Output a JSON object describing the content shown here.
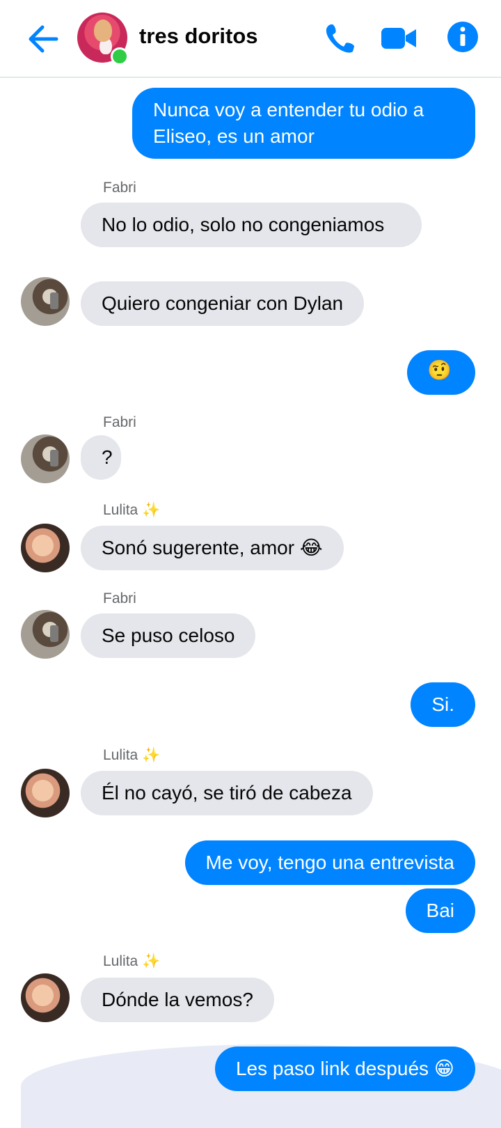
{
  "header": {
    "title": "tres doritos",
    "icons": [
      "back-arrow-icon",
      "phone-icon",
      "video-camera-icon",
      "info-icon"
    ],
    "accent_color": "#0084ff",
    "online_color": "#31cc46"
  },
  "messages": [
    {
      "sender": "me",
      "text": "Nunca voy a entender tu odio a Eliseo, es un amor"
    },
    {
      "sender": "Fabri",
      "label": "Fabri",
      "text": "No lo odio, solo no congeniamos"
    },
    {
      "sender": "Fabri",
      "text": "Quiero congeniar con Dylan"
    },
    {
      "sender": "me",
      "text": "🤨"
    },
    {
      "sender": "Fabri",
      "label": "Fabri",
      "text": "?"
    },
    {
      "sender": "Lulita",
      "label": "Lulita ✨",
      "text": "Sonó sugerente, amor 😂"
    },
    {
      "sender": "Fabri",
      "label": "Fabri",
      "text": "Se puso celoso"
    },
    {
      "sender": "me",
      "text": "Si."
    },
    {
      "sender": "Lulita",
      "label": "Lulita ✨",
      "text": "Él no cayó, se tiró de cabeza"
    },
    {
      "sender": "me",
      "text": "Me voy, tengo una entrevista"
    },
    {
      "sender": "me",
      "text": "Bai"
    },
    {
      "sender": "Lulita",
      "label": "Lulita ✨",
      "text": "Dónde la vemos?"
    },
    {
      "sender": "me",
      "text": "Les paso link después 😁"
    }
  ],
  "colors": {
    "incoming_bubble": "#e4e6eb",
    "outgoing_bubble": "#0084ff",
    "name_text": "#65676b"
  }
}
